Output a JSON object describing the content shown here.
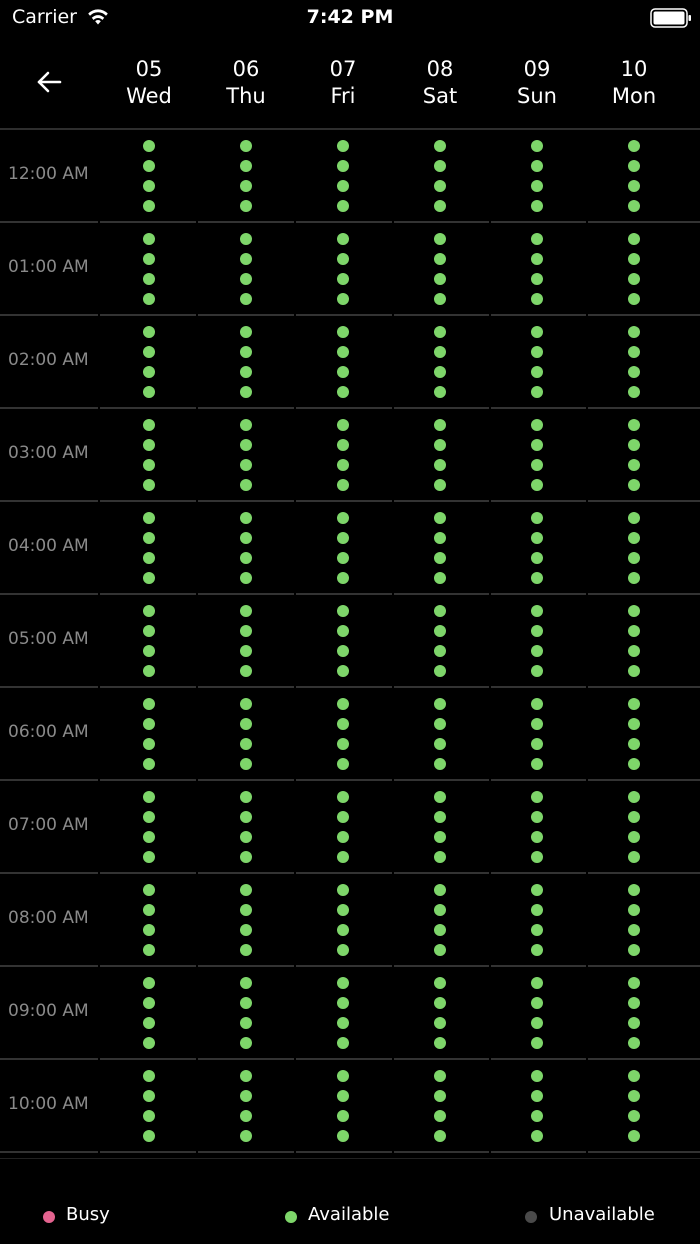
{
  "status_bar": {
    "carrier": "Carrier",
    "time": "7:42 PM",
    "wifi_icon": "wifi-icon",
    "battery_icon": "battery-icon"
  },
  "header": {
    "back_icon": "arrow-left-icon",
    "days": [
      {
        "date": "05",
        "weekday": "Wed"
      },
      {
        "date": "06",
        "weekday": "Thu"
      },
      {
        "date": "07",
        "weekday": "Fri"
      },
      {
        "date": "08",
        "weekday": "Sat"
      },
      {
        "date": "09",
        "weekday": "Sun"
      },
      {
        "date": "10",
        "weekday": "Mon"
      }
    ]
  },
  "schedule": {
    "slots_per_hour": 4,
    "hours": [
      {
        "label": "12:00 AM",
        "slots": [
          [
            "available",
            "available",
            "available",
            "available"
          ],
          [
            "available",
            "available",
            "available",
            "available"
          ],
          [
            "available",
            "available",
            "available",
            "available"
          ],
          [
            "available",
            "available",
            "available",
            "available"
          ],
          [
            "available",
            "available",
            "available",
            "available"
          ],
          [
            "available",
            "available",
            "available",
            "available"
          ]
        ]
      },
      {
        "label": "01:00 AM",
        "slots": [
          [
            "available",
            "available",
            "available",
            "available"
          ],
          [
            "available",
            "available",
            "available",
            "available"
          ],
          [
            "available",
            "available",
            "available",
            "available"
          ],
          [
            "available",
            "available",
            "available",
            "available"
          ],
          [
            "available",
            "available",
            "available",
            "available"
          ],
          [
            "available",
            "available",
            "available",
            "available"
          ]
        ]
      },
      {
        "label": "02:00 AM",
        "slots": [
          [
            "available",
            "available",
            "available",
            "available"
          ],
          [
            "available",
            "available",
            "available",
            "available"
          ],
          [
            "available",
            "available",
            "available",
            "available"
          ],
          [
            "available",
            "available",
            "available",
            "available"
          ],
          [
            "available",
            "available",
            "available",
            "available"
          ],
          [
            "available",
            "available",
            "available",
            "available"
          ]
        ]
      },
      {
        "label": "03:00 AM",
        "slots": [
          [
            "available",
            "available",
            "available",
            "available"
          ],
          [
            "available",
            "available",
            "available",
            "available"
          ],
          [
            "available",
            "available",
            "available",
            "available"
          ],
          [
            "available",
            "available",
            "available",
            "available"
          ],
          [
            "available",
            "available",
            "available",
            "available"
          ],
          [
            "available",
            "available",
            "available",
            "available"
          ]
        ]
      },
      {
        "label": "04:00 AM",
        "slots": [
          [
            "available",
            "available",
            "available",
            "available"
          ],
          [
            "available",
            "available",
            "available",
            "available"
          ],
          [
            "available",
            "available",
            "available",
            "available"
          ],
          [
            "available",
            "available",
            "available",
            "available"
          ],
          [
            "available",
            "available",
            "available",
            "available"
          ],
          [
            "available",
            "available",
            "available",
            "available"
          ]
        ]
      },
      {
        "label": "05:00 AM",
        "slots": [
          [
            "available",
            "available",
            "available",
            "available"
          ],
          [
            "available",
            "available",
            "available",
            "available"
          ],
          [
            "available",
            "available",
            "available",
            "available"
          ],
          [
            "available",
            "available",
            "available",
            "available"
          ],
          [
            "available",
            "available",
            "available",
            "available"
          ],
          [
            "available",
            "available",
            "available",
            "available"
          ]
        ]
      },
      {
        "label": "06:00 AM",
        "slots": [
          [
            "available",
            "available",
            "available",
            "available"
          ],
          [
            "available",
            "available",
            "available",
            "available"
          ],
          [
            "available",
            "available",
            "available",
            "available"
          ],
          [
            "available",
            "available",
            "available",
            "available"
          ],
          [
            "available",
            "available",
            "available",
            "available"
          ],
          [
            "available",
            "available",
            "available",
            "available"
          ]
        ]
      },
      {
        "label": "07:00 AM",
        "slots": [
          [
            "available",
            "available",
            "available",
            "available"
          ],
          [
            "available",
            "available",
            "available",
            "available"
          ],
          [
            "available",
            "available",
            "available",
            "available"
          ],
          [
            "available",
            "available",
            "available",
            "available"
          ],
          [
            "available",
            "available",
            "available",
            "available"
          ],
          [
            "available",
            "available",
            "available",
            "available"
          ]
        ]
      },
      {
        "label": "08:00 AM",
        "slots": [
          [
            "available",
            "available",
            "available",
            "available"
          ],
          [
            "available",
            "available",
            "available",
            "available"
          ],
          [
            "available",
            "available",
            "available",
            "available"
          ],
          [
            "available",
            "available",
            "available",
            "available"
          ],
          [
            "available",
            "available",
            "available",
            "available"
          ],
          [
            "available",
            "available",
            "available",
            "available"
          ]
        ]
      },
      {
        "label": "09:00 AM",
        "slots": [
          [
            "available",
            "available",
            "available",
            "available"
          ],
          [
            "available",
            "available",
            "available",
            "available"
          ],
          [
            "available",
            "available",
            "available",
            "available"
          ],
          [
            "available",
            "available",
            "available",
            "available"
          ],
          [
            "available",
            "available",
            "available",
            "available"
          ],
          [
            "available",
            "available",
            "available",
            "available"
          ]
        ]
      },
      {
        "label": "10:00 AM",
        "slots": [
          [
            "available",
            "available",
            "available",
            "available"
          ],
          [
            "available",
            "available",
            "available",
            "available"
          ],
          [
            "available",
            "available",
            "available",
            "available"
          ],
          [
            "available",
            "available",
            "available",
            "available"
          ],
          [
            "available",
            "available",
            "available",
            "available"
          ],
          [
            "available",
            "available",
            "available",
            "available"
          ]
        ]
      }
    ]
  },
  "legend": [
    {
      "label": "Busy",
      "status": "busy"
    },
    {
      "label": "Available",
      "status": "available"
    },
    {
      "label": "Unavailable",
      "status": "unavailable"
    }
  ],
  "colors": {
    "background": "#000000",
    "busy": "#e4638f",
    "available": "#7ed66a",
    "unavailable": "#4a4a4a",
    "hour_label": "#8a8a8a"
  }
}
